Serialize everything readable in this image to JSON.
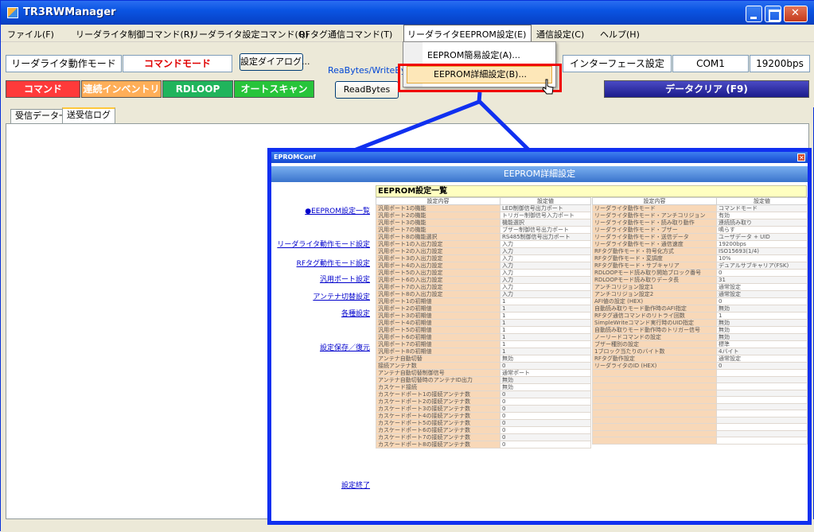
{
  "window": {
    "title": "TR3RWManager"
  },
  "menubar": {
    "items": [
      "ファイル(F)",
      "リーダライタ制御コマンド(R)",
      "リーダライタ設定コマンド(Q)",
      "RFタグ通信コマンド(T)",
      "リーダライタEEPROM設定(E)",
      "通信設定(C)",
      "ヘルプ(H)"
    ]
  },
  "toolbar": {
    "mode_label": "リーダライタ動作モード",
    "mode_value": "コマンドモード",
    "settings_dialog": "設定ダイアログ...",
    "group_label": "ReaBytes/WriteBy",
    "readbytes": "ReadBytes",
    "interface_label": "インターフェース設定",
    "port": "COM1",
    "baud": "19200bps",
    "buttons": {
      "command": "コマンド",
      "cont_inventory": "連続インベントリ",
      "rdloop": "RDLOOP",
      "autoscan": "オートスキャン",
      "data_clear": "データクリア (F9)"
    }
  },
  "dropdown": {
    "item1": "EEPROM簡易設定(A)...",
    "item2": "EEPROM詳細設定(B)..."
  },
  "tabs": [
    "受信データ一覧",
    "送受信ログ"
  ],
  "popup": {
    "window_title": "EPROMConf",
    "header": "EEPROM詳細設定",
    "section_title": "EEPROM設定一覧",
    "nav": [
      "●EEPROM設定一覧",
      "リーダライタ動作モード設定",
      "RFタグ動作モード設定",
      "汎用ポート設定",
      "アンテナ切替設定",
      "各種設定",
      "設定保存／復元",
      "設定終了"
    ],
    "col_key": "設定内容",
    "col_val": "設定値",
    "left_rows": [
      [
        "汎用ポート1の機能",
        "LED制御信号出力ポート"
      ],
      [
        "汎用ポート2の機能",
        "トリガー制御信号入力ポート"
      ],
      [
        "汎用ポート3の機能",
        "機能選択"
      ],
      [
        "汎用ポート7の機能",
        "ブザー制御信号出力ポート"
      ],
      [
        "汎用ポート8の機能選択",
        "RS485制御信号出力ポート"
      ],
      [
        "汎用ポート1の入出力設定",
        "入力"
      ],
      [
        "汎用ポート2の入出力設定",
        "入力"
      ],
      [
        "汎用ポート3の入出力設定",
        "入力"
      ],
      [
        "汎用ポート4の入出力設定",
        "入力"
      ],
      [
        "汎用ポート5の入出力設定",
        "入力"
      ],
      [
        "汎用ポート6の入出力設定",
        "入力"
      ],
      [
        "汎用ポート7の入出力設定",
        "入力"
      ],
      [
        "汎用ポート8の入出力設定",
        "入力"
      ],
      [
        "汎用ポート1の初期値",
        "1"
      ],
      [
        "汎用ポート2の初期値",
        "1"
      ],
      [
        "汎用ポート3の初期値",
        "1"
      ],
      [
        "汎用ポート4の初期値",
        "1"
      ],
      [
        "汎用ポート5の初期値",
        "1"
      ],
      [
        "汎用ポート6の初期値",
        "1"
      ],
      [
        "汎用ポート7の初期値",
        "1"
      ],
      [
        "汎用ポート8の初期値",
        "1"
      ],
      [
        "アンテナ自動切替",
        "無効"
      ],
      [
        "接続アンテナ数",
        "0"
      ],
      [
        "アンテナ自動切替制御信号",
        "通常ポート"
      ],
      [
        "アンテナ自動切替時のアンテナID出力",
        "無効"
      ],
      [
        "カスケード接続",
        "無効"
      ],
      [
        "カスケードポート1の接続アンテナ数",
        "0"
      ],
      [
        "カスケードポート2の接続アンテナ数",
        "0"
      ],
      [
        "カスケードポート3の接続アンテナ数",
        "0"
      ],
      [
        "カスケードポート4の接続アンテナ数",
        "0"
      ],
      [
        "カスケードポート5の接続アンテナ数",
        "0"
      ],
      [
        "カスケードポート6の接続アンテナ数",
        "0"
      ],
      [
        "カスケードポート7の接続アンテナ数",
        "0"
      ],
      [
        "カスケードポート8の接続アンテナ数",
        "0"
      ]
    ],
    "right_rows": [
      [
        "リーダライタ動作モード",
        "コマンドモード"
      ],
      [
        "リーダライタ動作モード・アンチコリジョン",
        "有効"
      ],
      [
        "リーダライタ動作モード・読み取り動作",
        "連続読み取り"
      ],
      [
        "リーダライタ動作モード・ブザー",
        "鳴らす"
      ],
      [
        "リーダライタ動作モード・送信データ",
        "ユーザデータ + UID"
      ],
      [
        "リーダライタ動作モード・通信速度",
        "19200bps"
      ],
      [
        "RFタグ動作モード・符号化方式",
        "ISO15693(1/4)"
      ],
      [
        "RFタグ動作モード・変調度",
        "10%"
      ],
      [
        "RFタグ動作モード・サブキャリア",
        "デュアルサブキャリア(FSK)"
      ],
      [
        "RDLOOPモード読み取り開始ブロック番号",
        "0"
      ],
      [
        "RDLOOPモード読み取りデータ長",
        "31"
      ],
      [
        "アンチコリジョン設定1",
        "通常設定"
      ],
      [
        "アンチコリジョン設定2",
        "通常設定"
      ],
      [
        "AFI値の設定 (HEX)",
        "0"
      ],
      [
        "自動読み取りモード動作時のAFI指定",
        "無効"
      ],
      [
        "RFタグ通信コマンドのリトライ回数",
        "1"
      ],
      [
        "SimpleWriteコマンド実行時のUID指定",
        "無効"
      ],
      [
        "自動読み取りモード動作時のトリガー信号",
        "無効"
      ],
      [
        "ノーリードコマンドの設定",
        "無効"
      ],
      [
        "ブザー種別の設定",
        "標準"
      ],
      [
        "1ブロック当たりのバイト数",
        "4バイト"
      ],
      [
        "RFタグ動作設定",
        "通常設定"
      ],
      [
        "リーダライタのID (HEX)",
        "0"
      ],
      [
        "",
        ""
      ],
      [
        "",
        ""
      ],
      [
        "",
        ""
      ],
      [
        "",
        ""
      ],
      [
        "",
        ""
      ],
      [
        "",
        ""
      ],
      [
        "",
        ""
      ],
      [
        "",
        ""
      ],
      [
        "",
        ""
      ],
      [
        "",
        ""
      ],
      [
        "",
        ""
      ]
    ]
  }
}
